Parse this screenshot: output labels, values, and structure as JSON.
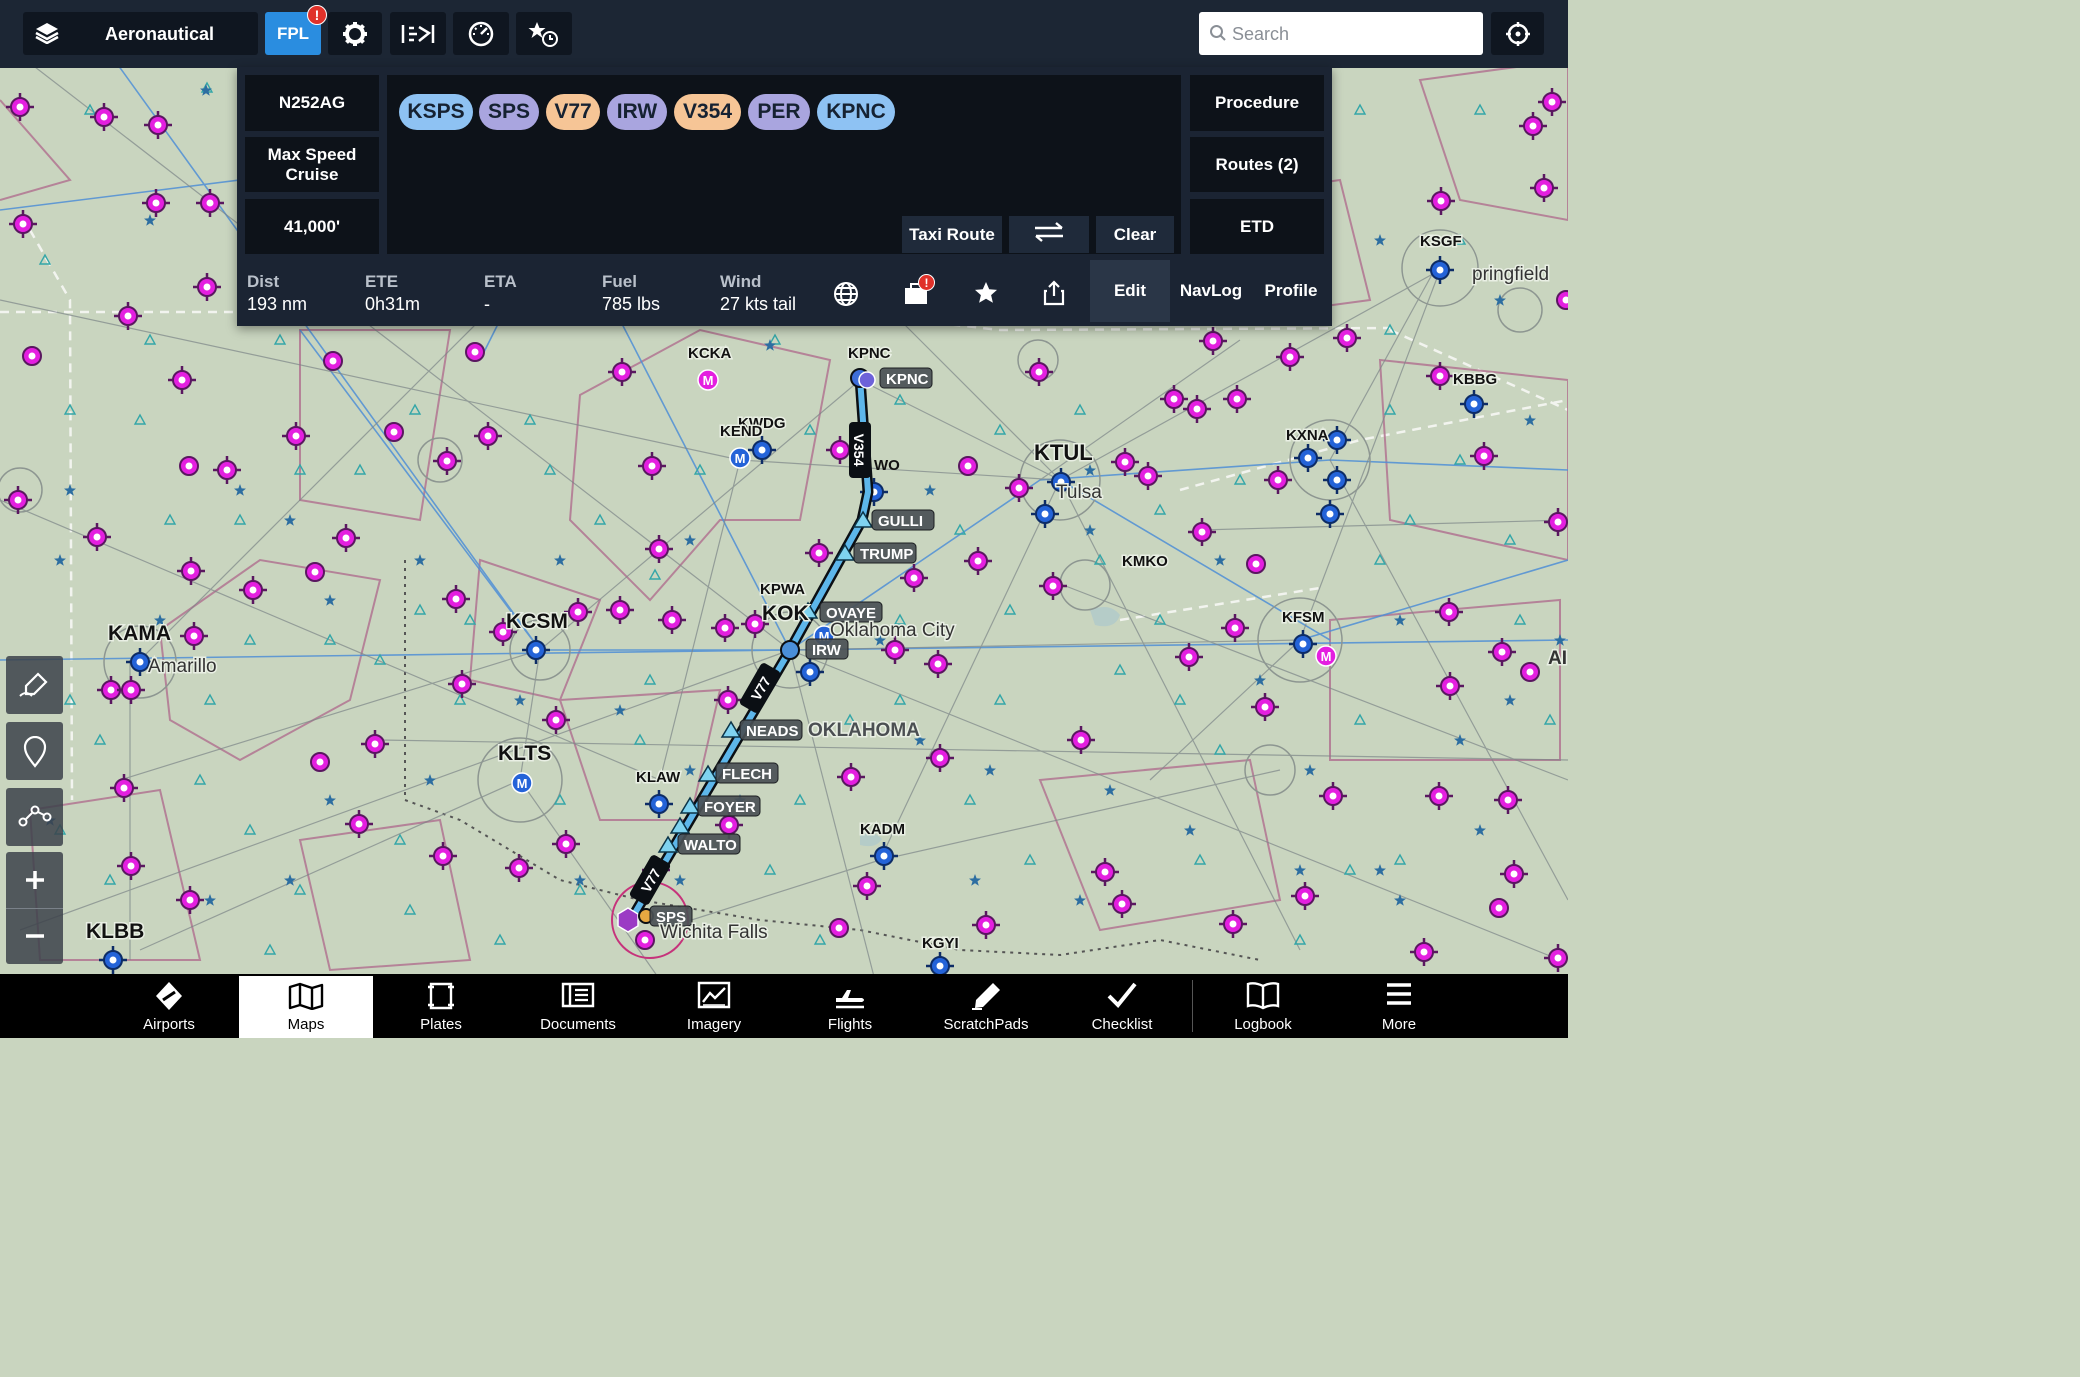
{
  "topbar": {
    "layer_label": "Aeronautical",
    "fpl_label": "FPL",
    "fpl_badge": "!",
    "search_placeholder": "Search",
    "icons": [
      "layers-icon",
      "gear-icon",
      "weather-imagery-icon",
      "gauge-icon",
      "favorites-recent-icon",
      "locate-icon"
    ]
  },
  "flight_plan": {
    "aircraft": "N252AG",
    "performance_line1": "Max Speed",
    "performance_line2": "Cruise",
    "altitude": "41,000'",
    "route": [
      {
        "id": "KSPS",
        "kind": "airport"
      },
      {
        "id": "SPS",
        "kind": "navaid"
      },
      {
        "id": "V77",
        "kind": "airway"
      },
      {
        "id": "IRW",
        "kind": "navaid"
      },
      {
        "id": "V354",
        "kind": "airway"
      },
      {
        "id": "PER",
        "kind": "navaid"
      },
      {
        "id": "KPNC",
        "kind": "airport"
      }
    ],
    "taxi_route": "Taxi Route",
    "clear": "Clear",
    "procedure": "Procedure",
    "routes": "Routes (2)",
    "etd": "ETD",
    "stats": {
      "dist_label": "Dist",
      "dist": "193 nm",
      "ete_label": "ETE",
      "ete": "0h31m",
      "eta_label": "ETA",
      "eta": "-",
      "fuel_label": "Fuel",
      "fuel": "785 lbs",
      "wind_label": "Wind",
      "wind": "27 kts tail"
    },
    "pack_badge": "!",
    "tabs": {
      "edit": "Edit",
      "navlog": "NavLog",
      "profile": "Profile"
    }
  },
  "map": {
    "airport_labels": [
      "KCKA",
      "KPNC",
      "KWDG",
      "KEND",
      "KTUL",
      "Tulsa",
      "KSGF",
      "pringfield",
      "KBBG",
      "KXNA",
      "KMKO",
      "KFSM",
      "KAMA",
      "Amarillo",
      "KCSM",
      "KPWA",
      "KOK",
      "Oklahoma City",
      "KLTS",
      "KLAW",
      "KADM",
      "KGYI",
      "KLBB",
      "Wichita Falls",
      "OKLAHOMA",
      "AI"
    ],
    "route_points": [
      "KPNC",
      "WO",
      "GULLI",
      "TRUMP",
      "OVAYE",
      "IRW",
      "NEADS",
      "FLECH",
      "FOYER",
      "WALTO",
      "SPS"
    ],
    "airway_tags": [
      "V354",
      "V77",
      "V77"
    ],
    "airport_badge": "M"
  },
  "map_tools": [
    "draw-icon",
    "pin-icon",
    "route-tool-icon",
    "zoom-in-icon",
    "zoom-out-icon"
  ],
  "bottombar": [
    {
      "label": "Airports",
      "icon": "airports-icon"
    },
    {
      "label": "Maps",
      "icon": "maps-icon",
      "active": true
    },
    {
      "label": "Plates",
      "icon": "plates-icon"
    },
    {
      "label": "Documents",
      "icon": "documents-icon"
    },
    {
      "label": "Imagery",
      "icon": "imagery-icon"
    },
    {
      "label": "Flights",
      "icon": "flights-icon"
    },
    {
      "label": "ScratchPads",
      "icon": "scratchpads-icon"
    },
    {
      "label": "Checklist",
      "icon": "checklist-icon"
    },
    {
      "label": "Logbook",
      "icon": "logbook-icon"
    },
    {
      "label": "More",
      "icon": "more-icon"
    }
  ],
  "colors": {
    "map_bg": "#c9d5bf",
    "airport_magenta": "#e41fe0",
    "airport_blue": "#2463d8",
    "route_blue": "#5db6ea",
    "topbar": "#1c2634",
    "accent": "#2a8de0"
  }
}
